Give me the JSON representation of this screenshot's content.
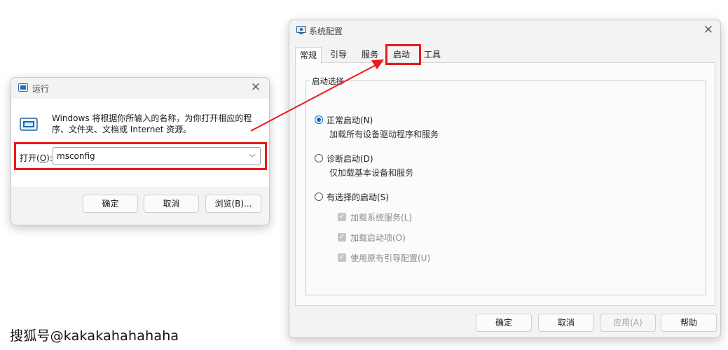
{
  "run_dialog": {
    "title": "运行",
    "description": "Windows 将根据你所输入的名称，为你打开相应的程序、文件夹、文档或 Internet 资源。",
    "open_label_prefix": "打开(",
    "open_label_key": "O",
    "open_label_suffix": "):",
    "input_value": "msconfig",
    "ok_button": "确定",
    "cancel_button": "取消",
    "browse_button": "浏览(B)..."
  },
  "msconfig_dialog": {
    "title": "系统配置",
    "tabs": [
      {
        "label": "常规",
        "active": true
      },
      {
        "label": "引导",
        "active": false
      },
      {
        "label": "服务",
        "active": false
      },
      {
        "label": "启动",
        "active": false
      },
      {
        "label": "工具",
        "active": false
      }
    ],
    "group_label": "启动选择",
    "options": [
      {
        "label": "正常启动(N)",
        "description": "加载所有设备驱动程序和服务",
        "selected": true
      },
      {
        "label": "诊断启动(D)",
        "description": "仅加载基本设备和服务",
        "selected": false
      },
      {
        "label": "有选择的启动(S)",
        "selected": false
      }
    ],
    "checkboxes": [
      {
        "label": "加载系统服务(L)",
        "checked": true,
        "disabled": true
      },
      {
        "label": "加载启动项(O)",
        "checked": true,
        "disabled": true
      },
      {
        "label": "使用原有引导配置(U)",
        "checked": true,
        "disabled": true
      }
    ],
    "buttons": {
      "ok": "确定",
      "cancel": "取消",
      "apply": "应用(A)",
      "help": "帮助"
    }
  },
  "watermark": "搜狐号@kakakahahahaha",
  "colors": {
    "highlight": "#e81b1b",
    "radio_accent": "#0067c0"
  }
}
